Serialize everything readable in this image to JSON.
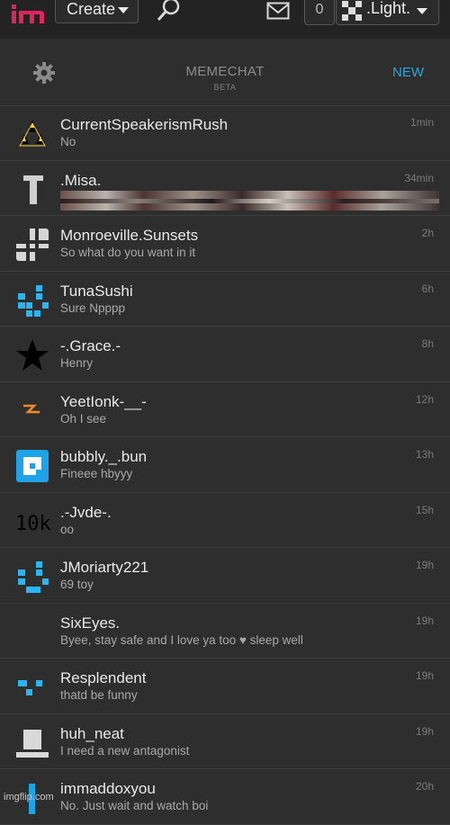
{
  "topbar": {
    "create_label": "Create",
    "notif_count": "0",
    "username": ".Light."
  },
  "chat_header": {
    "title": "MEMECHAT",
    "beta": "BETA",
    "new_label": "NEW"
  },
  "conversations": [
    {
      "name": "CurrentSpeakerismRush",
      "message": "No",
      "time": "1min",
      "avatar": "triangle-stars"
    },
    {
      "name": ".Misa.",
      "message": "",
      "time": "34min",
      "avatar": "grey-t",
      "has_image": true
    },
    {
      "name": "Monroeville.Sunsets",
      "message": "So what do you want in it",
      "time": "2h",
      "avatar": "grey-grid"
    },
    {
      "name": "TunaSushi",
      "message": "Sure Npppp",
      "time": "6h",
      "avatar": "blue-pixel"
    },
    {
      "name": "-.Grace.-",
      "message": "Henry",
      "time": "8h",
      "avatar": "black-star"
    },
    {
      "name": "YeetIonk-__-",
      "message": "Oh I see",
      "time": "12h",
      "avatar": "orange-zigzag"
    },
    {
      "name": "bubbly._.bun",
      "message": "Fineee hbyyy",
      "time": "13h",
      "avatar": "blue-square"
    },
    {
      "name": ".-Jvde-.",
      "message": "oo",
      "time": "15h",
      "avatar": "10k-text"
    },
    {
      "name": "JMoriarty221",
      "message": "69 toy",
      "time": "19h",
      "avatar": "blue-pixel-face"
    },
    {
      "name": "SixEyes.",
      "message": "Byee, stay safe and I love ya too ♥ sleep well",
      "time": "19h",
      "avatar": "none"
    },
    {
      "name": "Resplendent",
      "message": "thatd be funny",
      "time": "19h",
      "avatar": "blue-pixel-small"
    },
    {
      "name": "huh_neat",
      "message": "I need a new antagonist",
      "time": "19h",
      "avatar": "grey-block"
    },
    {
      "name": "immaddoxyou",
      "message": "No. Just wait and watch boi",
      "time": "20h",
      "avatar": "blue-bar"
    }
  ],
  "avatar_text": {
    "jvde": "10k"
  },
  "watermark": "imgflip.com",
  "colors": {
    "accent": "#2aa7e0",
    "background": "#2e2e2e",
    "topbar": "#232323"
  }
}
